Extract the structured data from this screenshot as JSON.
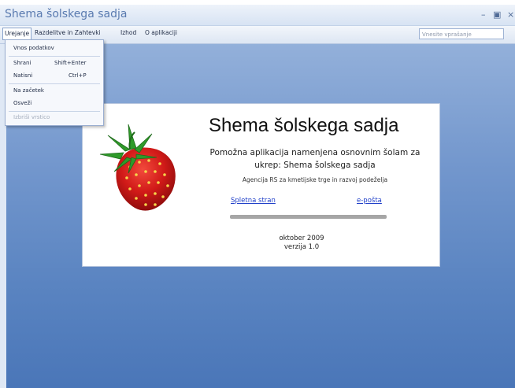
{
  "window": {
    "title": "Shema šolskega sadja",
    "minimize_glyph": "–",
    "maximize_glyph": "▣",
    "close_glyph": "×"
  },
  "menu": {
    "items": [
      "Urejanje",
      "Razdelitve in Zahtevki",
      "Izhod",
      "O aplikaciji"
    ],
    "search_placeholder": "Vnesite vprašanje"
  },
  "dropdown": {
    "items": [
      {
        "label": "Vnos podatkov",
        "shortcut": ""
      },
      {
        "label": "Shrani",
        "shortcut": "Shift+Enter"
      },
      {
        "label": "Natisni",
        "shortcut": "Ctrl+P"
      },
      {
        "label": "Na začetek",
        "shortcut": ""
      },
      {
        "label": "Osveži",
        "shortcut": ""
      },
      {
        "label": "Izbriši vrstico",
        "shortcut": "",
        "disabled": true
      }
    ]
  },
  "splash": {
    "title": "Shema šolskega sadja",
    "description": "Pomožna aplikacija namenjena osnovnim šolam za ukrep: Shema šolskega sadja",
    "agency": "Agencija RS za kmetijske trge in razvoj podeželja",
    "link_web": "Spletna stran",
    "link_email": "e-pošta",
    "date": "oktober 2009",
    "version": "verzija 1.0",
    "image": "strawberry-icon"
  },
  "colors": {
    "accent": "#5a84c1",
    "link": "#1f3fc8"
  }
}
